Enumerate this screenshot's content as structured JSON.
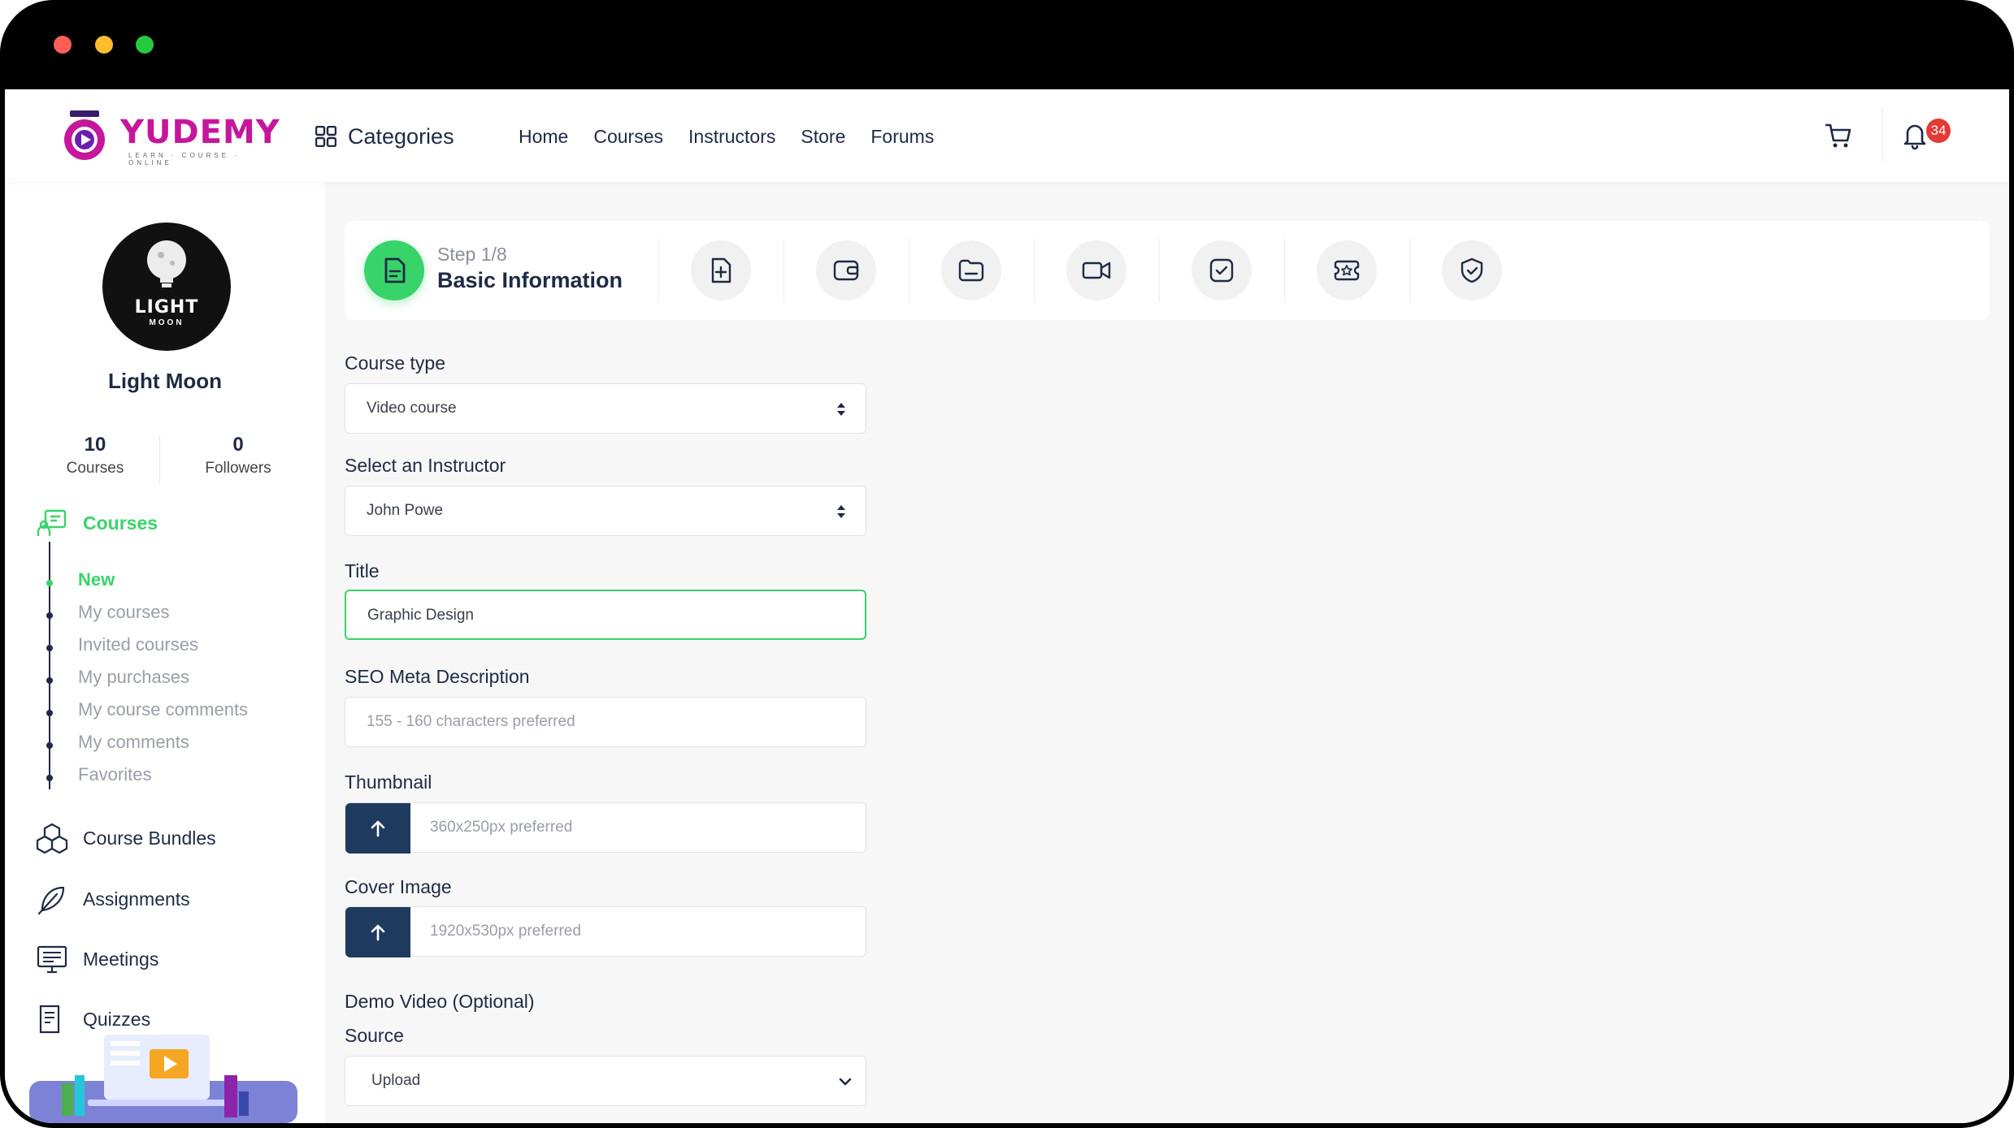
{
  "brand": {
    "name": "YUDEMY",
    "tagline": "LEARN · COURSE · ONLINE",
    "color": "#c5169c"
  },
  "nav": {
    "categories_label": "Categories",
    "links": [
      "Home",
      "Courses",
      "Instructors",
      "Store",
      "Forums"
    ],
    "notification_count": "34"
  },
  "user": {
    "avatar_line1": "LIGHT",
    "avatar_line2": "MOON",
    "name": "Light Moon",
    "courses_count": "10",
    "courses_label": "Courses",
    "followers_count": "0",
    "followers_label": "Followers"
  },
  "sidebar": {
    "courses_label": "Courses",
    "sub_items": [
      "New",
      "My courses",
      "Invited courses",
      "My purchases",
      "My course comments",
      "My comments",
      "Favorites"
    ],
    "course_bundles": "Course Bundles",
    "assignments": "Assignments",
    "meetings": "Meetings",
    "quizzes": "Quizzes"
  },
  "steps": {
    "current": "Step 1/8",
    "title": "Basic Information",
    "icons": [
      "file-plus-icon",
      "wallet-icon",
      "folder-icon",
      "video-camera-icon",
      "checkbox-icon",
      "ticket-star-icon",
      "shield-check-icon"
    ]
  },
  "form": {
    "course_type": {
      "label": "Course type",
      "value": "Video course"
    },
    "instructor": {
      "label": "Select an Instructor",
      "value": "John Powe"
    },
    "title": {
      "label": "Title",
      "value": "Graphic Design"
    },
    "seo": {
      "label": "SEO Meta Description",
      "placeholder": "155 - 160 characters preferred"
    },
    "thumbnail": {
      "label": "Thumbnail",
      "placeholder": "360x250px preferred"
    },
    "cover": {
      "label": "Cover Image",
      "placeholder": "1920x530px preferred"
    },
    "demo_video": {
      "label": "Demo Video (Optional)"
    },
    "source": {
      "label": "Source",
      "value": "Upload"
    }
  },
  "colors": {
    "accent": "#38d46a",
    "navy": "#1f3a5f",
    "badge": "#e53935"
  }
}
